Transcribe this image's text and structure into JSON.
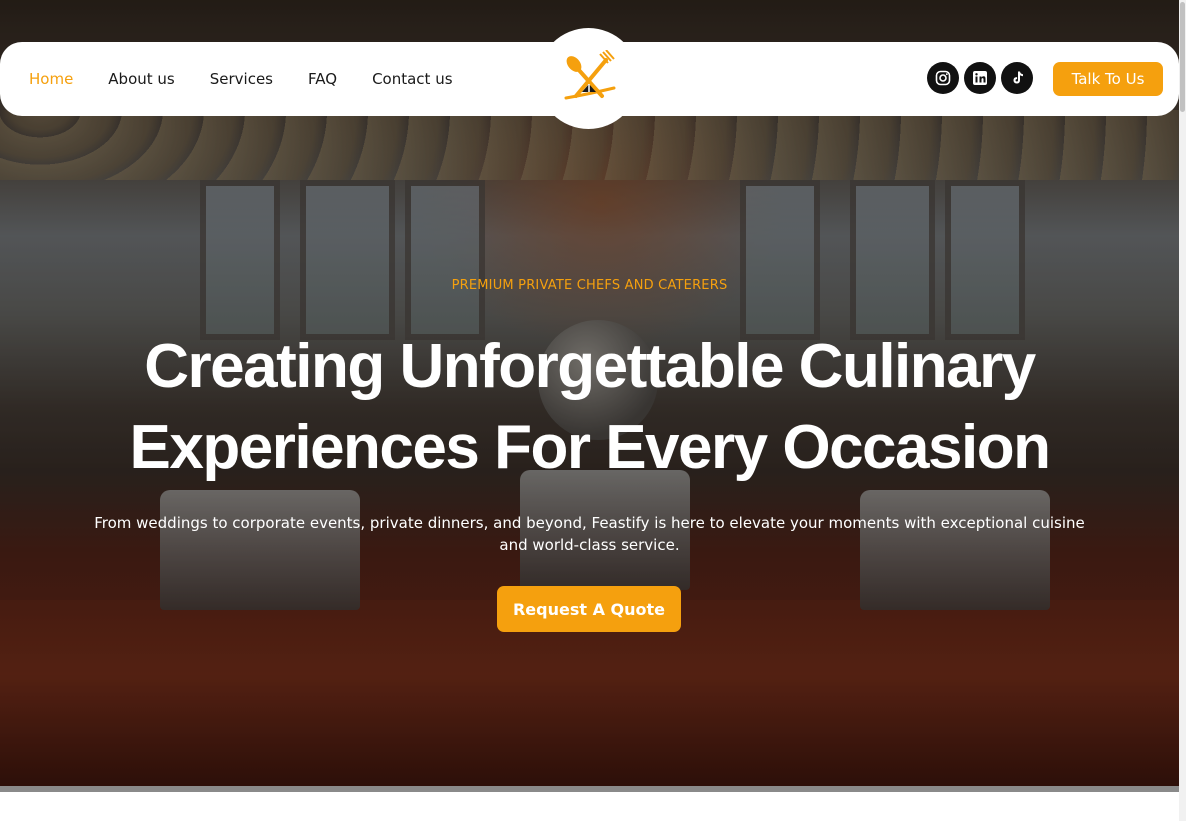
{
  "nav": {
    "links": [
      {
        "label": "Home"
      },
      {
        "label": "About us"
      },
      {
        "label": "Services"
      },
      {
        "label": "FAQ"
      },
      {
        "label": "Contact us"
      }
    ],
    "active_index": 0
  },
  "social": [
    {
      "icon": "instagram-icon"
    },
    {
      "icon": "linkedin-icon"
    },
    {
      "icon": "tiktok-icon"
    }
  ],
  "header_cta": {
    "label": "Talk To Us"
  },
  "hero": {
    "eyebrow": "PREMIUM PRIVATE CHEFS AND CATERERS",
    "headline_line1": "Creating Unforgettable Culinary",
    "headline_line2": "Experiences For Every Occasion",
    "subtext": "From weddings to corporate events, private dinners, and beyond, Feastify is here to elevate your moments with exceptional cuisine and world-class service.",
    "cta_label": "Request A Quote"
  },
  "colors": {
    "accent": "#f5a00e",
    "text_dark": "#1a1a1a",
    "social_bg": "#111111"
  }
}
